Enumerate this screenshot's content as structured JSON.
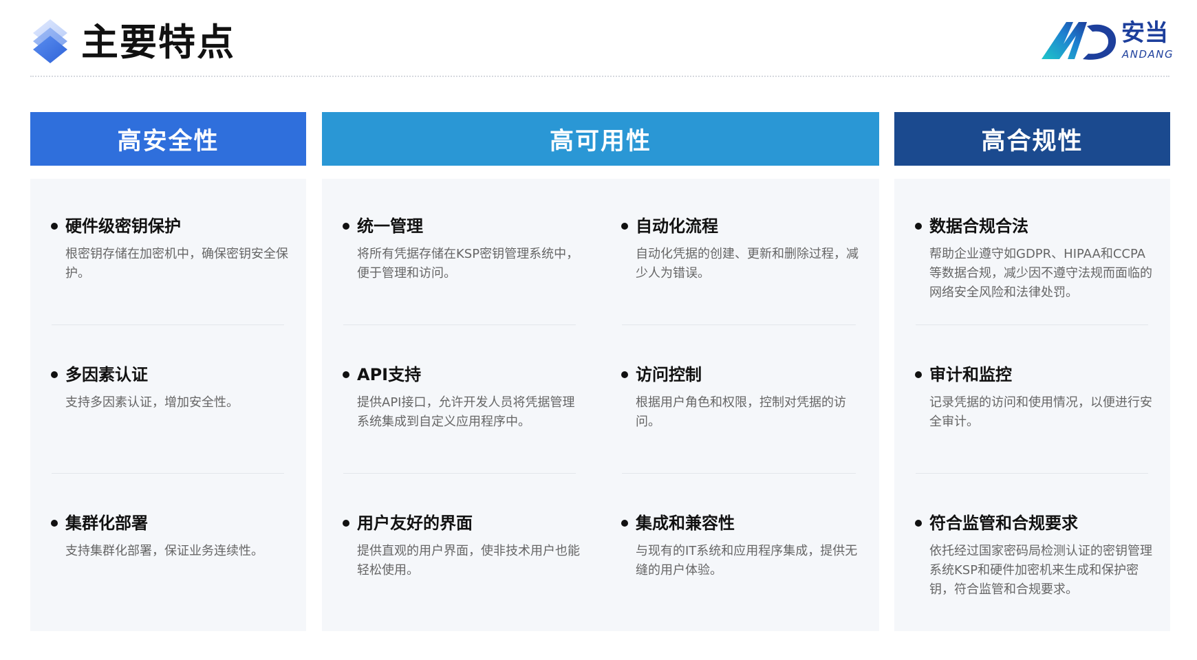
{
  "page_title": "主要特点",
  "logo": {
    "cn": "安当",
    "en": "ANDANG"
  },
  "colors": {
    "security": "#2f6fdc",
    "availability": "#2a97d5",
    "compliance": "#1b4a8f",
    "panel_bg": "#f5f7fa"
  },
  "icons": {
    "title_icon": "stacked-layers-icon",
    "bullet": "bullet-dot-icon"
  },
  "columns": {
    "security": {
      "title": "高安全性",
      "items": [
        {
          "title": "硬件级密钥保护",
          "desc": "根密钥存储在加密机中，确保密钥安全保护。"
        },
        {
          "title": "多因素认证",
          "desc": "支持多因素认证，增加安全性。"
        },
        {
          "title": "集群化部署",
          "desc": "支持集群化部署，保证业务连续性。"
        }
      ]
    },
    "availability": {
      "title": "高可用性",
      "left_items": [
        {
          "title": "统一管理",
          "desc": "将所有凭据存储在KSP密钥管理系统中，便于管理和访问。"
        },
        {
          "title": "API支持",
          "desc": "提供API接口，允许开发人员将凭据管理系统集成到自定义应用程序中。"
        },
        {
          "title": "用户友好的界面",
          "desc": "提供直观的用户界面，使非技术用户也能轻松使用。"
        }
      ],
      "right_items": [
        {
          "title": "自动化流程",
          "desc": "自动化凭据的创建、更新和删除过程，减少人为错误。"
        },
        {
          "title": "访问控制",
          "desc": "根据用户角色和权限，控制对凭据的访问。"
        },
        {
          "title": "集成和兼容性",
          "desc": "与现有的IT系统和应用程序集成，提供无缝的用户体验。"
        }
      ]
    },
    "compliance": {
      "title": "高合规性",
      "items": [
        {
          "title": "数据合规合法",
          "desc": "帮助企业遵守如GDPR、HIPAA和CCPA等数据合规，减少因不遵守法规而面临的网络安全风险和法律处罚。"
        },
        {
          "title": "审计和监控",
          "desc": "记录凭据的访问和使用情况，以便进行安全审计。"
        },
        {
          "title": "符合监管和合规要求",
          "desc": "依托经过国家密码局检测认证的密钥管理系统KSP和硬件加密机来生成和保护密钥，符合监管和合规要求。"
        }
      ]
    }
  }
}
